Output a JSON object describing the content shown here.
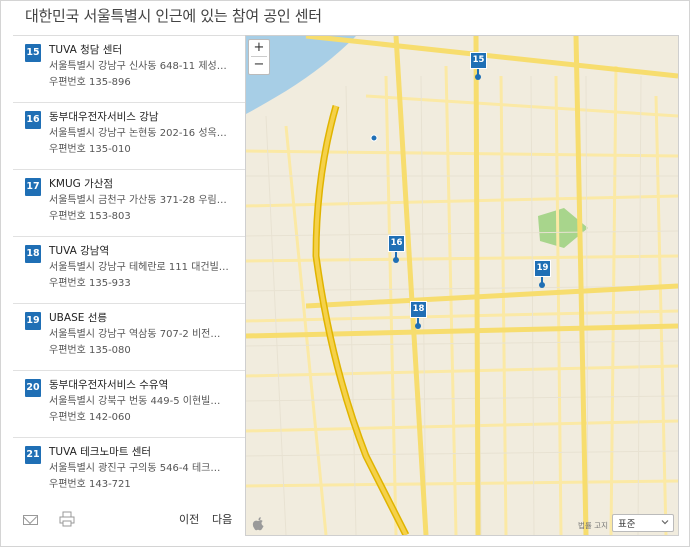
{
  "page_title": "대한민국 서울특별시 인근에 있는 참여 공인 센터",
  "results": [
    {
      "num": "15",
      "name": "TUVA 청담 센터",
      "address": "서울특별시 강남구 신사동 648-11 제성…",
      "zip": "우편번호 135-896"
    },
    {
      "num": "16",
      "name": "동부대우전자서비스 강남",
      "address": "서울특별시 강남구 논현동 202-16 성옥…",
      "zip": "우편번호 135-010"
    },
    {
      "num": "17",
      "name": "KMUG 가산점",
      "address": "서울특별시 금천구 가산동 371-28 우림…",
      "zip": "우편번호 153-803"
    },
    {
      "num": "18",
      "name": "TUVA 강남역",
      "address": "서울특별시 강남구 테헤란로 111 대건빌…",
      "zip": "우편번호 135-933"
    },
    {
      "num": "19",
      "name": "UBASE 선릉",
      "address": "서울특별시 강남구 역삼동 707-2 비전…",
      "zip": "우편번호 135-080"
    },
    {
      "num": "20",
      "name": "동부대우전자서비스 수유역",
      "address": "서울특별시 강북구 번동 449-5 이현빌…",
      "zip": "우편번호 142-060"
    },
    {
      "num": "21",
      "name": "TUVA 테크노마트 센터",
      "address": "서울특별시 광진구 구의동 546-4 테크…",
      "zip": "우편번호 143-721"
    }
  ],
  "footer": {
    "prev_label": "이전",
    "next_label": "다음"
  },
  "map": {
    "zoom_in": "+",
    "zoom_out": "−",
    "pins": [
      {
        "num": "15"
      },
      {
        "num": "16"
      },
      {
        "num": "18"
      },
      {
        "num": "19"
      }
    ],
    "legal_text": "법률 고지",
    "map_type_value": "표준"
  },
  "colors": {
    "accent": "#1f6fb5",
    "water": "#a7cee6",
    "road_major": "#f5d14a",
    "road_minor": "#fbe9a5",
    "park": "#a8d58c"
  }
}
